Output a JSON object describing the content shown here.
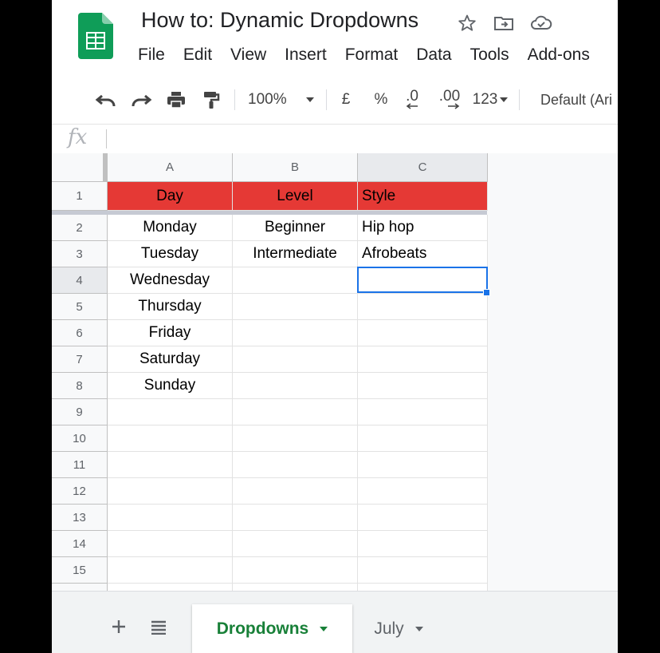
{
  "doc": {
    "title": "How to: Dynamic Dropdowns"
  },
  "menu": [
    "File",
    "Edit",
    "View",
    "Insert",
    "Format",
    "Data",
    "Tools",
    "Add-ons"
  ],
  "toolbar": {
    "zoom": "100%",
    "currency": "£",
    "percent": "%",
    "dec_decrease": ".0",
    "dec_increase": ".00",
    "more_formats": "123",
    "font": "Default (Ari"
  },
  "formula_bar": {
    "fx_label": "fx",
    "value": ""
  },
  "grid": {
    "columns": [
      "A",
      "B",
      "C"
    ],
    "rows": [
      "1",
      "2",
      "3",
      "4",
      "5",
      "6",
      "7",
      "8",
      "9",
      "10",
      "11",
      "12",
      "13",
      "14",
      "15"
    ],
    "header_row": [
      "Day",
      "Level",
      "Style"
    ],
    "cells": [
      [
        "Monday",
        "Beginner",
        "Hip hop"
      ],
      [
        "Tuesday",
        "Intermediate",
        "Afrobeats"
      ],
      [
        "Wednesday",
        "",
        ""
      ],
      [
        "Thursday",
        "",
        ""
      ],
      [
        "Friday",
        "",
        ""
      ],
      [
        "Saturday",
        "",
        ""
      ],
      [
        "Sunday",
        "",
        ""
      ]
    ],
    "selected_cell": "C4"
  },
  "sheets": {
    "tabs": [
      "Dropdowns",
      "July"
    ],
    "active": "Dropdowns"
  },
  "colors": {
    "header_fill": "#e53935",
    "selection": "#1a73e8",
    "active_tab_text": "#188038",
    "logo_green": "#0f9d58"
  }
}
